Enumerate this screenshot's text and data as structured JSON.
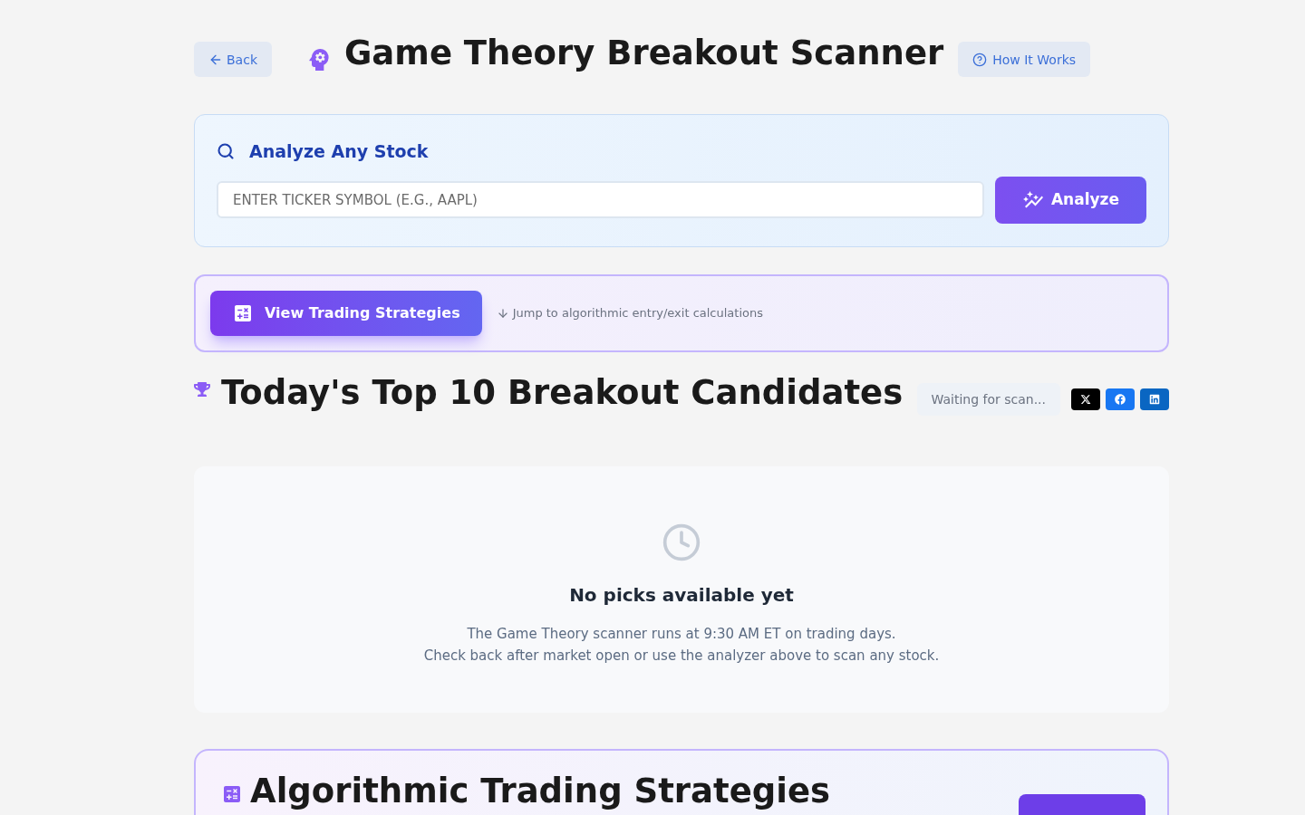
{
  "header": {
    "back_button": "Back",
    "title": "Game Theory Breakout Scanner",
    "help_button": "How It Works"
  },
  "analyzer": {
    "title": "Analyze Any Stock",
    "ticker_field": {
      "placeholder": "ENTER TICKER SYMBOL (E.G., AAPL)"
    },
    "analyze_button": "Analyze"
  },
  "strategies_banner": {
    "button": "View Trading Strategies",
    "hint": "Jump to algorithmic entry/exit calculations"
  },
  "candidates": {
    "title": "Today's Top 10 Breakout Candidates",
    "status": "Waiting for scan...",
    "share_buttons": [
      {
        "kind": "x"
      },
      {
        "kind": "facebook"
      },
      {
        "kind": "linkedin"
      }
    ]
  },
  "empty_state": {
    "title": "No picks available yet",
    "lines": [
      "The Game Theory scanner runs at 9:30 AM ET on trading days.",
      "Check back after market open or use the analyzer above to scan any stock."
    ]
  },
  "strategies_section": {
    "title": "Algorithmic Trading Strategies"
  }
}
